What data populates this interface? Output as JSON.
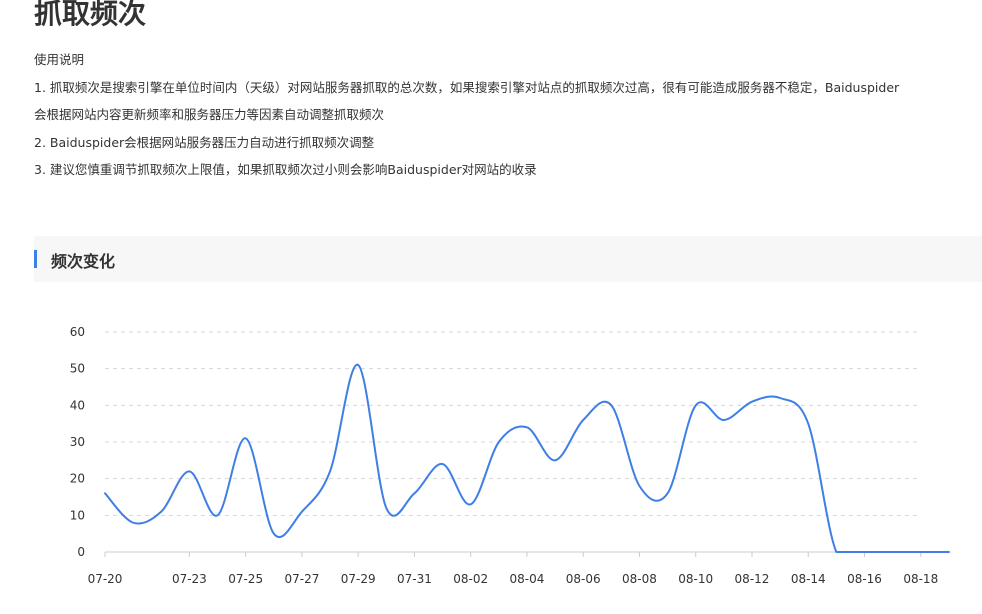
{
  "page": {
    "title": "抓取频次"
  },
  "usage": {
    "heading": "使用说明",
    "lines": [
      "1. 抓取频次是搜索引擎在单位时间内（天级）对网站服务器抓取的总次数，如果搜索引擎对站点的抓取频次过高，很有可能造成服务器不稳定，Baiduspider",
      "会根据网站内容更新频率和服务器压力等因素自动调整抓取频次",
      "2. Baiduspider会根据网站服务器压力自动进行抓取频次调整",
      "3. 建议您慎重调节抓取频次上限值，如果抓取频次过小则会影响Baiduspider对网站的收录"
    ]
  },
  "section": {
    "title": "频次变化"
  },
  "colors": {
    "accent": "#3c82e6",
    "line": "#3f7fe5",
    "grid": "#d8d8d8",
    "text": "#333333",
    "header_bg": "#f7f7f7"
  },
  "chart_data": {
    "type": "line",
    "title": "",
    "xlabel": "",
    "ylabel": "",
    "ylim": [
      0,
      60
    ],
    "yticks": [
      "0",
      "10",
      "20",
      "30",
      "40",
      "50",
      "60"
    ],
    "xticks": [
      "07-20",
      "07-23",
      "07-25",
      "07-27",
      "07-29",
      "07-31",
      "08-02",
      "08-04",
      "08-06",
      "08-08",
      "08-10",
      "08-12",
      "08-14",
      "08-16",
      "08-18"
    ],
    "grid": true,
    "x": [
      "07-20",
      "07-21",
      "07-22",
      "07-23",
      "07-24",
      "07-25",
      "07-26",
      "07-27",
      "07-28",
      "07-29",
      "07-30",
      "07-31",
      "08-01",
      "08-02",
      "08-03",
      "08-04",
      "08-05",
      "08-06",
      "08-07",
      "08-08",
      "08-09",
      "08-10",
      "08-11",
      "08-12",
      "08-13",
      "08-14",
      "08-15",
      "08-16",
      "08-17",
      "08-18",
      "08-19"
    ],
    "series": [
      {
        "values": [
          16,
          8,
          11,
          22,
          10,
          31,
          5,
          11,
          22,
          51,
          12,
          16,
          24,
          13,
          30,
          34,
          25,
          36,
          40,
          18,
          16,
          40,
          36,
          41,
          42,
          35,
          0,
          0,
          0,
          0,
          0
        ]
      }
    ]
  }
}
